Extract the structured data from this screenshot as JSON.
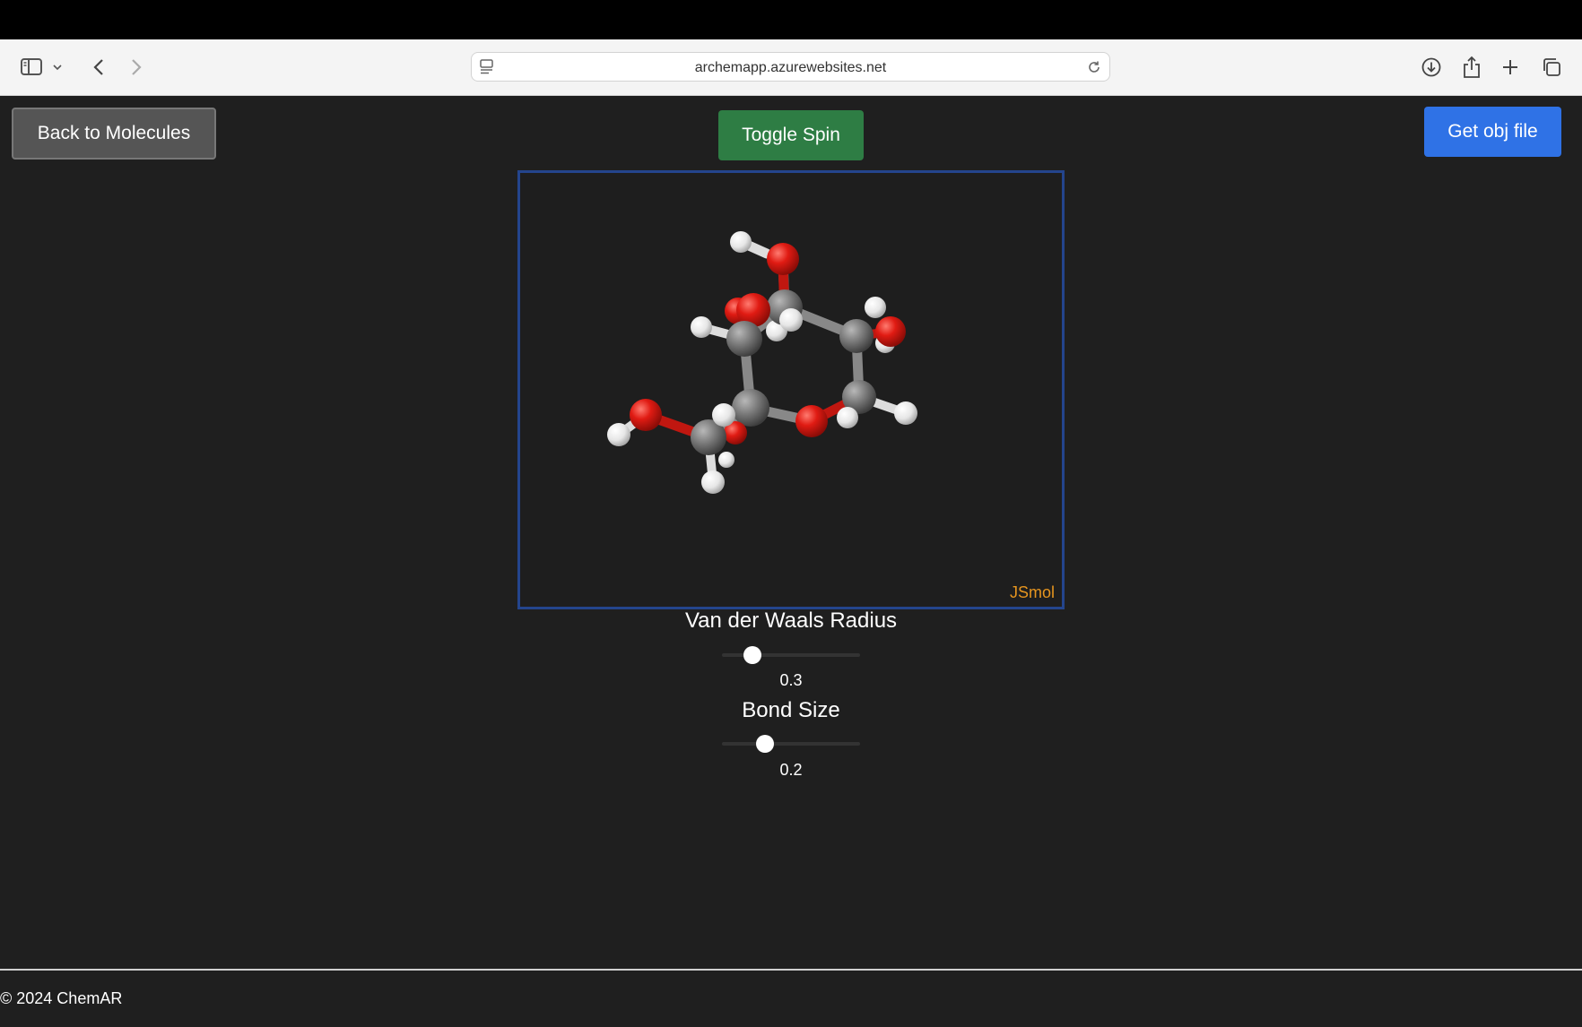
{
  "browser": {
    "address": "archemapp.azurewebsites.net"
  },
  "header": {
    "back_label": "Back to Molecules",
    "toggle_label": "Toggle Spin",
    "obj_label": "Get obj file"
  },
  "viewer": {
    "watermark": "JSmol",
    "molecule_style": "ball-and-stick"
  },
  "controls": {
    "vdw": {
      "title": "Van der Waals Radius",
      "value": "0.3",
      "fraction": 0.18
    },
    "bond": {
      "title": "Bond Size",
      "value": "0.2",
      "fraction": 0.28
    }
  },
  "footer": {
    "text": "© 2024 ChemAR"
  },
  "colors": {
    "page_bg": "#1f1f1f",
    "back_button": "#555555",
    "toggle_button": "#2e7d44",
    "obj_button": "#2f72e6",
    "viewer_border": "#24458d",
    "jsmol_label": "#e6951f",
    "oxygen": "#e01b13",
    "carbon": "#777777",
    "hydrogen": "#f0f0f0"
  }
}
